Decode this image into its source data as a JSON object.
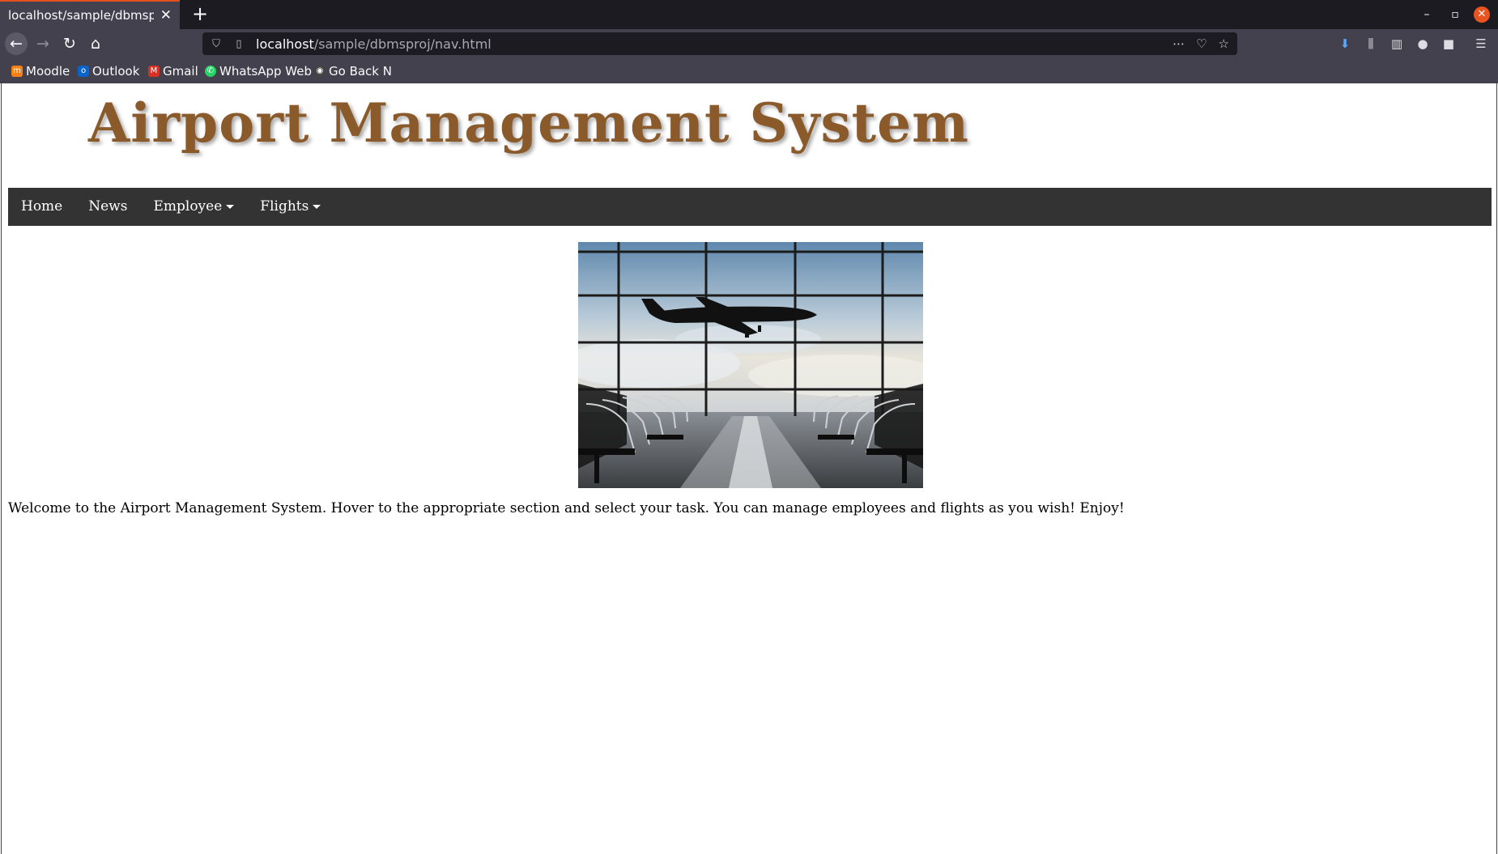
{
  "browser": {
    "tab_title": "localhost/sample/dbmsproj/nav.html",
    "url_host": "localhost",
    "url_path": "/sample/dbmsproj/nav.html",
    "bookmarks": [
      "Moodle",
      "Outlook",
      "Gmail",
      "WhatsApp Web",
      "Go Back N"
    ]
  },
  "site": {
    "title": "Airport Management System",
    "nav": {
      "home": "Home",
      "news": "News",
      "employee": "Employee",
      "flights": "Flights"
    },
    "welcome_text": "Welcome to the Airport Management System. Hover to the appropriate section and select your task. You can manage employees and flights as you wish! Enjoy!"
  },
  "colors": {
    "title": "#8b5a2b",
    "nav_bg": "#333333",
    "nav_text": "#ffffff",
    "accent_tab": "#e3501c"
  }
}
